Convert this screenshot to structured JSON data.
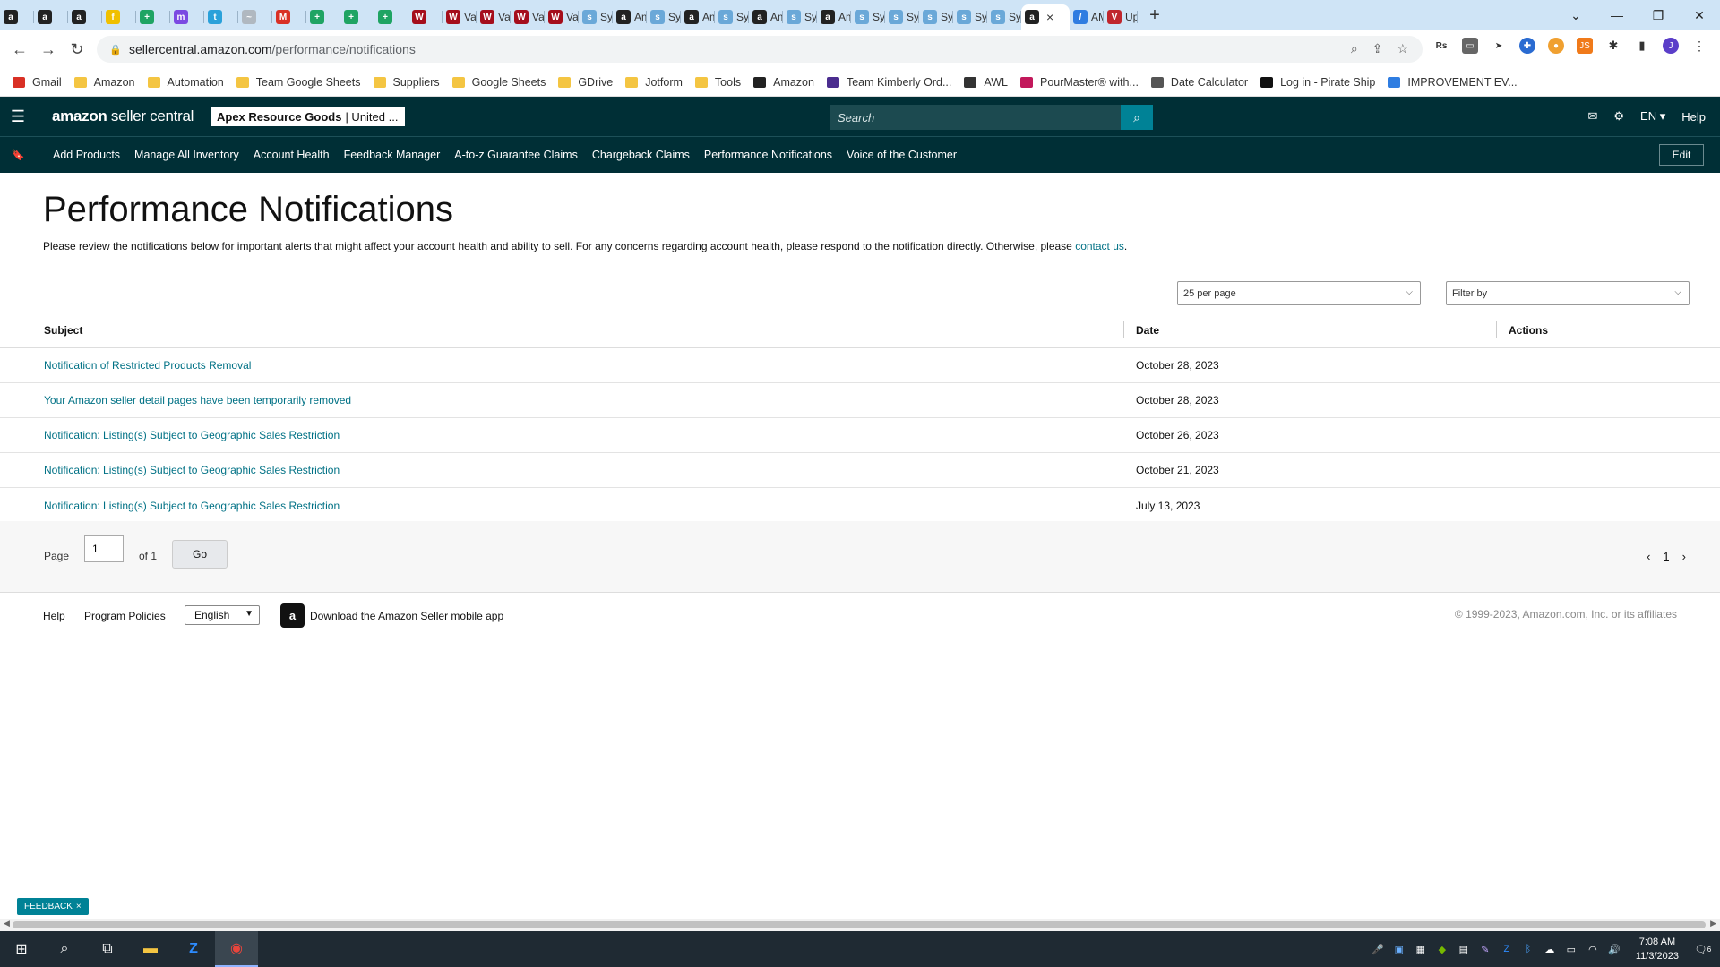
{
  "browser": {
    "tabs": [
      {
        "icon": "amazon-icon",
        "title": "",
        "color": "#222222",
        "glyph": "a"
      },
      {
        "icon": "amazon-icon",
        "title": "",
        "color": "#222222",
        "glyph": "a"
      },
      {
        "icon": "amazon-icon",
        "title": "",
        "color": "#222222",
        "glyph": "a"
      },
      {
        "icon": "pen-icon",
        "title": "",
        "color": "#f0c000",
        "glyph": "f"
      },
      {
        "icon": "sheets-icon",
        "title": "",
        "color": "#1fa463",
        "glyph": "+"
      },
      {
        "icon": "messenger-icon",
        "title": "",
        "color": "#7b4ae2",
        "glyph": "m"
      },
      {
        "icon": "telegram-icon",
        "title": "",
        "color": "#2aa1da",
        "glyph": "t"
      },
      {
        "icon": "doc-icon",
        "title": "",
        "color": "#b0b8c0",
        "glyph": "~"
      },
      {
        "icon": "gmail-icon",
        "title": "",
        "color": "#d93025",
        "glyph": "M"
      },
      {
        "icon": "sheets-icon",
        "title": "",
        "color": "#1fa463",
        "glyph": "+"
      },
      {
        "icon": "sheets-icon",
        "title": "",
        "color": "#1fa463",
        "glyph": "+"
      },
      {
        "icon": "sheets-icon",
        "title": "",
        "color": "#1fa463",
        "glyph": "+"
      },
      {
        "icon": "vw-icon",
        "title": "",
        "color": "#a50e1c",
        "glyph": "W"
      },
      {
        "icon": "vw-icon",
        "title": "Val",
        "color": "#a50e1c",
        "glyph": "W"
      },
      {
        "icon": "vw-icon",
        "title": "Val",
        "color": "#a50e1c",
        "glyph": "W"
      },
      {
        "icon": "vw-icon",
        "title": "Val",
        "color": "#a50e1c",
        "glyph": "W"
      },
      {
        "icon": "vw-icon",
        "title": "Val",
        "color": "#a50e1c",
        "glyph": "W"
      },
      {
        "icon": "sysco-icon",
        "title": "Sys",
        "color": "#6aa8d8",
        "glyph": "s"
      },
      {
        "icon": "amazon-icon",
        "title": "Am",
        "color": "#222222",
        "glyph": "a"
      },
      {
        "icon": "sysco-icon",
        "title": "Sys",
        "color": "#6aa8d8",
        "glyph": "s"
      },
      {
        "icon": "amazon-icon",
        "title": "Am",
        "color": "#222222",
        "glyph": "a"
      },
      {
        "icon": "sysco-icon",
        "title": "Sys",
        "color": "#6aa8d8",
        "glyph": "s"
      },
      {
        "icon": "amazon-icon",
        "title": "Am",
        "color": "#222222",
        "glyph": "a"
      },
      {
        "icon": "sysco-icon",
        "title": "Sys",
        "color": "#6aa8d8",
        "glyph": "s"
      },
      {
        "icon": "amazon-icon",
        "title": "Am",
        "color": "#222222",
        "glyph": "a"
      },
      {
        "icon": "sysco-icon",
        "title": "Sys",
        "color": "#6aa8d8",
        "glyph": "s"
      },
      {
        "icon": "sysco-icon",
        "title": "Sys",
        "color": "#6aa8d8",
        "glyph": "s"
      },
      {
        "icon": "sysco-icon",
        "title": "Sys",
        "color": "#6aa8d8",
        "glyph": "s"
      },
      {
        "icon": "sysco-icon",
        "title": "Sys",
        "color": "#6aa8d8",
        "glyph": "s"
      },
      {
        "icon": "sysco-icon",
        "title": "Sys",
        "color": "#6aa8d8",
        "glyph": "s"
      }
    ],
    "active_tab": {
      "icon": "amazon-icon",
      "glyph": "a",
      "close": "×"
    },
    "trailing_tabs": [
      {
        "icon": "pen-icon",
        "title": "AM",
        "color": "#2f7de1",
        "glyph": "/"
      },
      {
        "icon": "pirate-ship-icon",
        "title": "Up",
        "color": "#c0262d",
        "glyph": "V"
      }
    ],
    "new_tab": "+",
    "window_controls": [
      "⌄",
      "—",
      "❐",
      "✕"
    ],
    "url_host": "sellercentral.amazon.com",
    "url_path": "/performance/notifications",
    "bookmarks": [
      {
        "label": "Gmail",
        "icon": "gmail-icon",
        "color": "#d93025"
      },
      {
        "label": "Amazon",
        "icon": "folder-icon",
        "color": "#f4c542"
      },
      {
        "label": "Automation",
        "icon": "folder-icon",
        "color": "#f4c542"
      },
      {
        "label": "Team Google Sheets",
        "icon": "folder-icon",
        "color": "#f4c542"
      },
      {
        "label": "Suppliers",
        "icon": "folder-icon",
        "color": "#f4c542"
      },
      {
        "label": "Google Sheets",
        "icon": "folder-icon",
        "color": "#f4c542"
      },
      {
        "label": "GDrive",
        "icon": "folder-icon",
        "color": "#f4c542"
      },
      {
        "label": "Jotform",
        "icon": "folder-icon",
        "color": "#f4c542"
      },
      {
        "label": "Tools",
        "icon": "folder-icon",
        "color": "#f4c542"
      },
      {
        "label": "Amazon",
        "icon": "amazon-icon",
        "color": "#222222"
      },
      {
        "label": "Team Kimberly Ord...",
        "icon": "form-icon",
        "color": "#4b2d8f"
      },
      {
        "label": "AWL",
        "icon": "globe-icon",
        "color": "#333333"
      },
      {
        "label": "PourMaster® with...",
        "icon": "pourmaster-icon",
        "color": "#c2185b"
      },
      {
        "label": "Date Calculator",
        "icon": "calculator-icon",
        "color": "#555555"
      },
      {
        "label": "Log in - Pirate Ship",
        "icon": "pirate-ship-icon",
        "color": "#111111"
      },
      {
        "label": "IMPROVEMENT EV...",
        "icon": "pen-icon",
        "color": "#2f7de1"
      }
    ]
  },
  "seller_central": {
    "logo_bold": "amazon",
    "logo_light": " seller central",
    "store_name": "Apex Resource Goods",
    "store_region": "| United ...",
    "search_placeholder": "Search",
    "language": "EN ▾",
    "help": "Help",
    "nav_links": [
      "Add Products",
      "Manage All Inventory",
      "Account Health",
      "Feedback Manager",
      "A-to-z Guarantee Claims",
      "Chargeback Claims",
      "Performance Notifications",
      "Voice of the Customer"
    ],
    "edit": "Edit"
  },
  "main": {
    "title": "Performance Notifications",
    "intro": "Please review the notifications below for important alerts that might affect your account health and ability to sell. For any concerns regarding account health, please respond to the notification directly. Otherwise, please ",
    "intro_link": "contact us",
    "intro_end": ".",
    "per_page": "25 per page",
    "filter": "Filter by",
    "columns": {
      "subject": "Subject",
      "date": "Date",
      "actions": "Actions"
    },
    "rows": [
      {
        "subject": "Notification of Restricted Products Removal",
        "date": "October 28, 2023"
      },
      {
        "subject": "Your Amazon seller detail pages have been temporarily removed",
        "date": "October 28, 2023"
      },
      {
        "subject": "Notification: Listing(s) Subject to Geographic Sales Restriction",
        "date": "October 26, 2023"
      },
      {
        "subject": "Notification: Listing(s) Subject to Geographic Sales Restriction",
        "date": "October 21, 2023"
      },
      {
        "subject": "Notification: Listing(s) Subject to Geographic Sales Restriction",
        "date": "July 13, 2023"
      }
    ],
    "pagination": {
      "page_label": "Page",
      "page_value": "1",
      "of": "of 1",
      "go": "Go",
      "current": "1"
    }
  },
  "footer": {
    "help": "Help",
    "policies": "Program Policies",
    "language": "English",
    "app": "Download the Amazon Seller mobile app",
    "copyright": "© 1999-2023, Amazon.com, Inc. or its affiliates"
  },
  "feedback": {
    "label": "FEEDBACK",
    "close": "×"
  },
  "taskbar": {
    "time": "7:08 AM",
    "date": "11/3/2023",
    "notifications": "6"
  }
}
